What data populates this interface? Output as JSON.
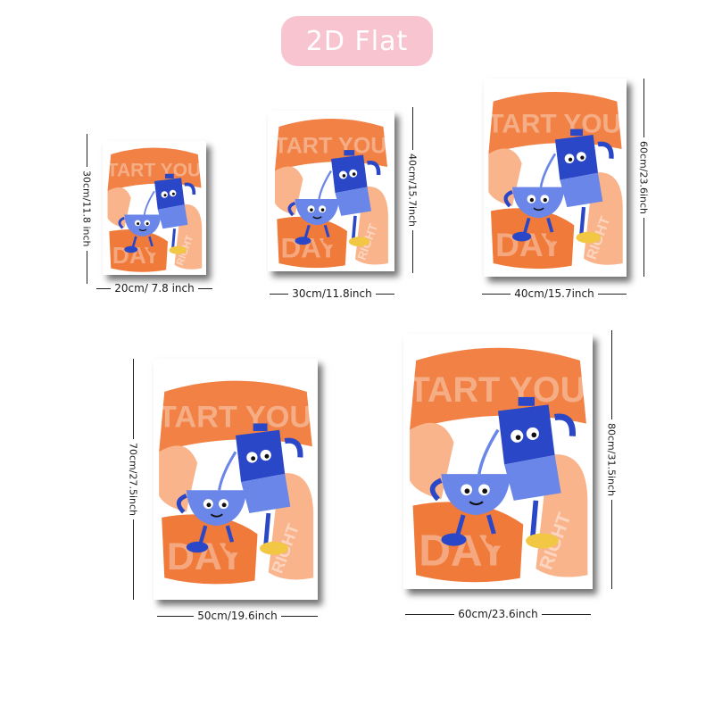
{
  "badge": {
    "label": "2D Flat",
    "color": "#f7c4d0"
  },
  "artwork": {
    "title_top": "START YOUR",
    "title_bottom": "DAY",
    "title_side": "RIGHT",
    "colors": {
      "orange": "#f07a3a",
      "peach": "#f9b48c",
      "blue": "#2a47c8",
      "light_blue": "#6a86e8",
      "yellow": "#f2c744"
    }
  },
  "sizes": [
    {
      "width_label": "20cm/ 7.8 inch",
      "height_label": "30cm/11.8 inch"
    },
    {
      "width_label": "30cm/11.8inch",
      "height_label": "40cm/15.7inch"
    },
    {
      "width_label": "40cm/15.7inch",
      "height_label": "60cm/23.6inch"
    },
    {
      "width_label": "50cm/19.6inch",
      "height_label": "70cm/27.5inch"
    },
    {
      "width_label": "60cm/23.6inch",
      "height_label": "80cm/31.5inch"
    }
  ]
}
